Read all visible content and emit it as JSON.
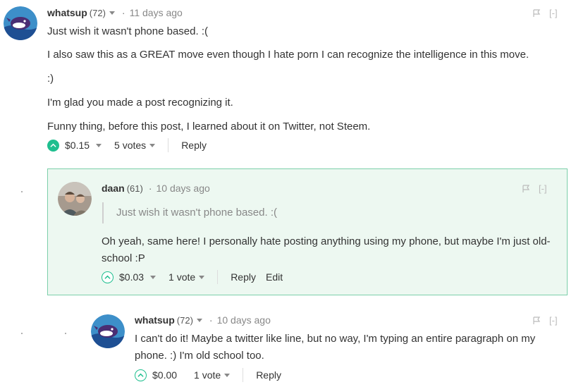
{
  "comments": [
    {
      "author": "whatsup",
      "rep": "(72)",
      "time": "11 days ago",
      "paragraphs": [
        "Just wish it wasn't phone based. :(",
        "I also saw this as a GREAT move even though I hate porn I can recognize the intelligence in this move.",
        ":)",
        "I'm glad you made a post recognizing it.",
        "Funny thing, before this post, I learned about it on Twitter, not Steem."
      ],
      "payout": "$0.15",
      "votes": "5 votes",
      "reply_label": "Reply",
      "collapse_label": "[-]"
    },
    {
      "author": "daan",
      "rep": "(61)",
      "time": "10 days ago",
      "quote": "Just wish it wasn't phone based. :(",
      "body": "Oh yeah, same here! I personally hate posting anything using my phone, but maybe I'm just old-school :P",
      "payout": "$0.03",
      "votes": "1 vote",
      "reply_label": "Reply",
      "edit_label": "Edit",
      "collapse_label": "[-]"
    },
    {
      "author": "whatsup",
      "rep": "(72)",
      "time": "10 days ago",
      "body": "I can't do it! Maybe a twitter like line, but no way, I'm typing an entire paragraph on my phone. :) I'm old school too.",
      "payout": "$0.00",
      "votes": "1 vote",
      "reply_label": "Reply",
      "collapse_label": "[-]"
    }
  ],
  "colors": {
    "accent": "#1fbf8f",
    "highlight_bg": "#edf8f1",
    "highlight_border": "#7ccfaa"
  },
  "icons": [
    "flag-icon",
    "upvote-icon",
    "chevron-down-icon",
    "whale-avatar",
    "user-photo-avatar"
  ]
}
